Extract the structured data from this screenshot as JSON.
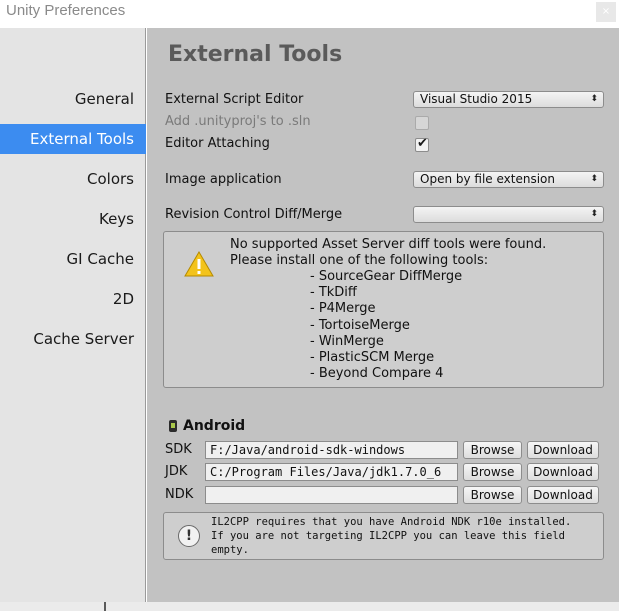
{
  "window": {
    "title": "Unity Preferences",
    "close_glyph": "×"
  },
  "sidebar": {
    "items": [
      {
        "label": "General",
        "selected": false
      },
      {
        "label": "External Tools",
        "selected": true
      },
      {
        "label": "Colors",
        "selected": false
      },
      {
        "label": "Keys",
        "selected": false
      },
      {
        "label": "GI Cache",
        "selected": false
      },
      {
        "label": "2D",
        "selected": false
      },
      {
        "label": "Cache Server",
        "selected": false
      }
    ]
  },
  "main": {
    "heading": "External Tools",
    "script_editor": {
      "label": "External Script Editor",
      "value": "Visual Studio 2015"
    },
    "add_unityproj": {
      "label": "Add .unityproj's to .sln",
      "checked": false,
      "enabled": false
    },
    "editor_attaching": {
      "label": "Editor Attaching",
      "checked": true
    },
    "image_application": {
      "label": "Image application",
      "value": "Open by file extension"
    },
    "revision_control": {
      "label": "Revision Control Diff/Merge",
      "value": ""
    },
    "popup_arrows": "⬍",
    "check_glyph": "✔",
    "warning": {
      "icon": "warning-icon",
      "lines": [
        "No supported Asset Server diff tools were found.",
        "Please install one of the following tools:",
        "- SourceGear DiffMerge",
        "- TkDiff",
        "- P4Merge",
        "- TortoiseMerge",
        "- WinMerge",
        "- PlasticSCM Merge",
        "- Beyond Compare 4"
      ]
    },
    "android": {
      "title": "Android",
      "icon": "android-icon",
      "sdk": {
        "label": "SDK",
        "value": "F:/Java/android-sdk-windows"
      },
      "jdk": {
        "label": "JDK",
        "value": "C:/Program Files/Java/jdk1.7.0_6"
      },
      "ndk": {
        "label": "NDK",
        "value": ""
      },
      "browse_label": "Browse",
      "download_label": "Download"
    },
    "info": {
      "icon": "info-icon",
      "glyph": "!",
      "lines": [
        "IL2CPP requires that you have Android NDK r10e installed.",
        "If you are not targeting IL2CPP you can leave this field",
        "empty."
      ]
    }
  },
  "colors": {
    "selected_nav": "#3c8cf0",
    "sidebar_bg": "#e4e4e4",
    "content_bg": "#c2c2c2",
    "warning_yellow": "#f3c31b"
  }
}
